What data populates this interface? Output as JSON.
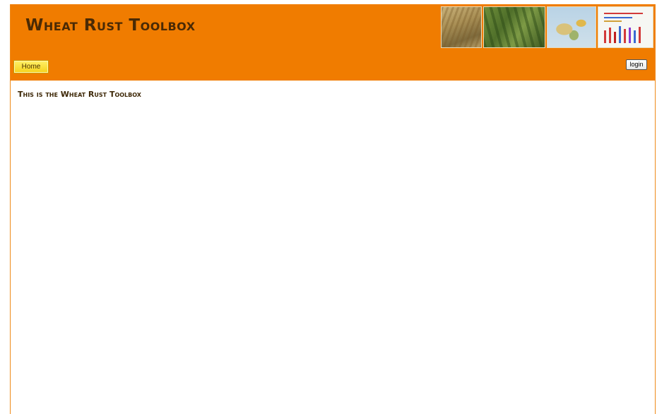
{
  "header": {
    "title": "Wheat Rust Toolbox",
    "banner_images": [
      "wheat-ears-photo",
      "rusted-leaf-photo",
      "rust-distribution-map",
      "rust-data-chart"
    ],
    "background_color": "#f07c00"
  },
  "nav": {
    "home_label": "Home",
    "login_label": "login"
  },
  "main": {
    "heading": "This is the Wheat Rust Toolbox"
  }
}
